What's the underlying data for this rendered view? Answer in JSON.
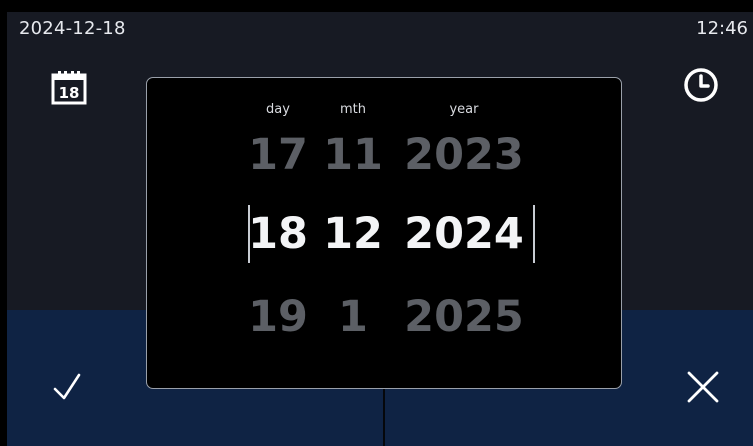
{
  "status_bar": {
    "date": "2024-12-18",
    "time": "12:46"
  },
  "calendar_icon": {
    "day_number": "18"
  },
  "picker": {
    "labels": {
      "day": "day",
      "month": "mth",
      "year": "year"
    },
    "previous": {
      "day": "17",
      "month": "11",
      "year": "2023"
    },
    "selected": {
      "day": "18",
      "month": "12",
      "year": "2024"
    },
    "next": {
      "day": "19",
      "month": "1",
      "year": "2025"
    }
  },
  "colors": {
    "screen_background": "#171a23",
    "bottom_bar": "#0f2344",
    "picker_background": "#000000",
    "picker_border": "#9aa0aa",
    "selected_text": "#f3f4f6",
    "dimmed_text": "#5c5f65"
  },
  "icons": {
    "calendar": "calendar-icon",
    "clock": "clock-icon",
    "confirm": "checkmark-icon",
    "cancel": "close-icon"
  }
}
